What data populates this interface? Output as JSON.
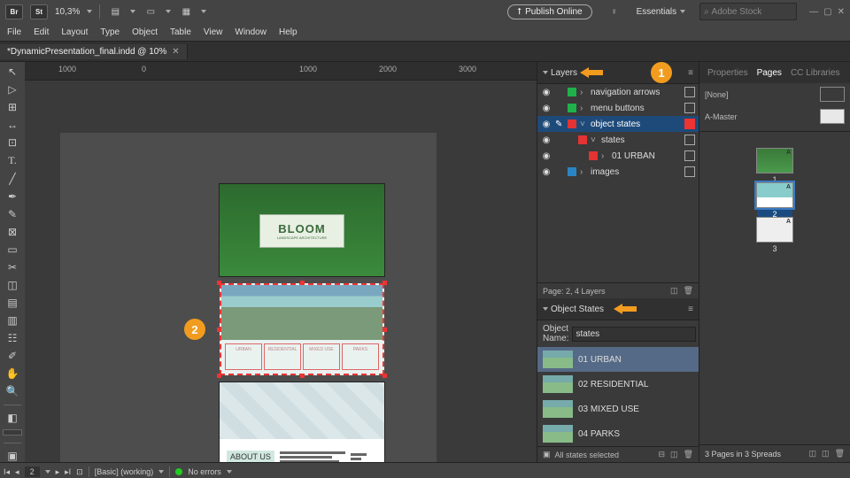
{
  "topbar": {
    "zoom": "10,3%",
    "publish": "Publish Online",
    "workspace": "Essentials",
    "stock_placeholder": "Adobe Stock"
  },
  "menu": [
    "File",
    "Edit",
    "Layout",
    "Type",
    "Object",
    "Table",
    "View",
    "Window",
    "Help"
  ],
  "doc": {
    "tab": "*DynamicPresentation_final.indd @ 10%"
  },
  "ruler": {
    "ticks": [
      "1000",
      "0",
      "1000",
      "2000",
      "3000"
    ]
  },
  "page1": {
    "title": "BLOOM",
    "subtitle": "LANDSCAPE ARCHITECTURE"
  },
  "page2": {
    "btns": [
      "URBAN",
      "RESIDENTIAL",
      "MIXED USE",
      "PARKS"
    ]
  },
  "page3": {
    "label": "ABOUT US"
  },
  "layers_panel": {
    "title": "Layers",
    "rows": [
      {
        "swatch": "#1fb14a",
        "name": "navigation arrows",
        "disclosure": "r"
      },
      {
        "swatch": "#1fb14a",
        "name": "menu buttons",
        "disclosure": "r"
      },
      {
        "swatch": "#e33333",
        "name": "object states",
        "disclosure": "d",
        "selected": true,
        "locked": true
      },
      {
        "swatch": "#e33333",
        "name": "states",
        "disclosure": "d",
        "child": 1
      },
      {
        "swatch": "#e33333",
        "name": "01 URBAN",
        "disclosure": "r",
        "child": 2
      },
      {
        "swatch": "#2a84c4",
        "name": "images",
        "disclosure": "r"
      }
    ],
    "status": "Page: 2, 4 Layers"
  },
  "objstates": {
    "title": "Object States",
    "name_label": "Object Name:",
    "name_value": "states",
    "states": [
      {
        "label": "01 URBAN",
        "selected": true
      },
      {
        "label": "02 RESIDENTIAL"
      },
      {
        "label": "03 MIXED USE"
      },
      {
        "label": "04 PARKS"
      }
    ],
    "footer": "All states selected"
  },
  "pages_panel": {
    "tabs": [
      "Properties",
      "Pages",
      "CC Libraries"
    ],
    "none": "[None]",
    "master": "A-Master",
    "pages": [
      "1",
      "2",
      "3"
    ],
    "footer": "3 Pages in 3 Spreads"
  },
  "statusbar": {
    "page": "2",
    "preset": "[Basic] (working)",
    "errors": "No errors"
  },
  "callouts": {
    "c1": "1",
    "c2": "2"
  },
  "chart_data": null
}
